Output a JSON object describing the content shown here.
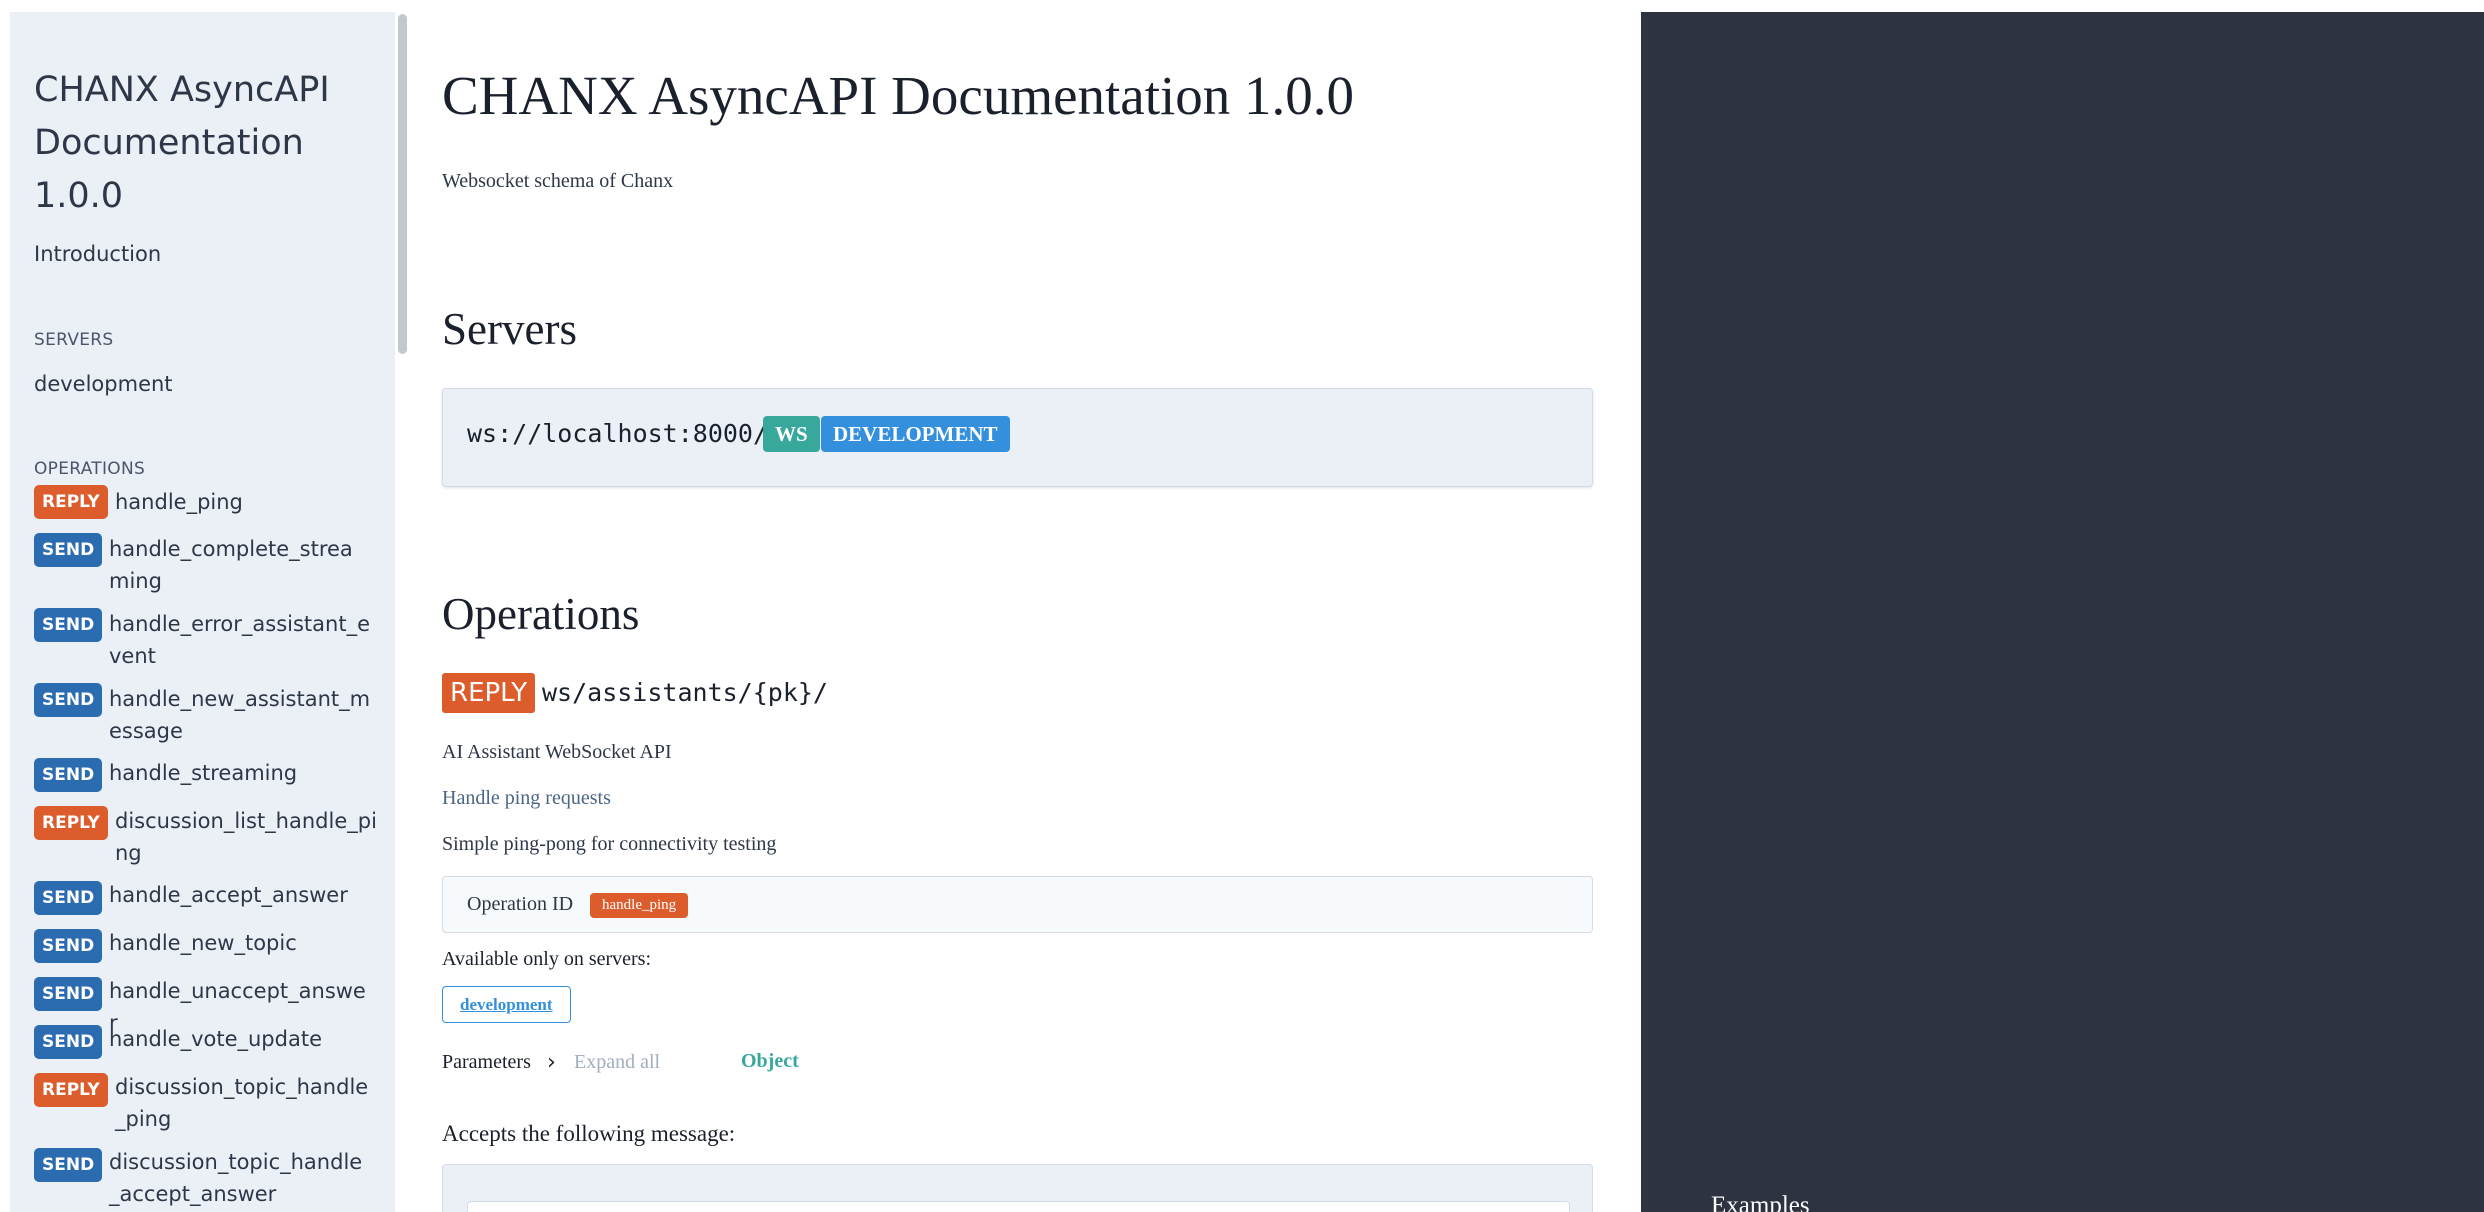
{
  "sidebar": {
    "title": "CHANX AsyncAPI Documentation 1.0.0",
    "introduction": "Introduction",
    "servers_heading": "SERVERS",
    "servers": [
      "development"
    ],
    "operations_heading": "OPERATIONS",
    "operations": [
      {
        "type": "REPLY",
        "name": "handle_ping"
      },
      {
        "type": "SEND",
        "name": "handle_complete_streaming"
      },
      {
        "type": "SEND",
        "name": "handle_error_assistant_event"
      },
      {
        "type": "SEND",
        "name": "handle_new_assistant_message"
      },
      {
        "type": "SEND",
        "name": "handle_streaming"
      },
      {
        "type": "REPLY",
        "name": "discussion_list_handle_ping"
      },
      {
        "type": "SEND",
        "name": "handle_accept_answer"
      },
      {
        "type": "SEND",
        "name": "handle_new_topic"
      },
      {
        "type": "SEND",
        "name": "handle_unaccept_answer"
      },
      {
        "type": "SEND",
        "name": "handle_vote_update"
      },
      {
        "type": "REPLY",
        "name": "discussion_topic_handle_ping"
      },
      {
        "type": "SEND",
        "name": "discussion_topic_handle_accept_answer"
      }
    ]
  },
  "main": {
    "title": "CHANX AsyncAPI Documentation 1.0.0",
    "description": "Websocket schema of Chanx",
    "servers_heading": "Servers",
    "server": {
      "url": "ws://localhost:8000/",
      "protocol": "WS",
      "environment": "DEVELOPMENT"
    },
    "operations_heading": "Operations",
    "operation": {
      "type": "REPLY",
      "channel": "ws/assistants/{pk}/",
      "channel_description": "AI Assistant WebSocket API",
      "summary": "Handle ping requests",
      "description": "Simple ping-pong for connectivity testing",
      "operation_id_label": "Operation ID",
      "operation_id": "handle_ping",
      "available_label": "Available only on servers:",
      "available_server": "development",
      "parameters_label": "Parameters",
      "expand_all": "Expand all",
      "parameters_type": "Object",
      "accepts_label": "Accepts the following message:"
    }
  },
  "right_panel": {
    "examples_label": "Examples"
  },
  "colors": {
    "reply": "#dd5c2c",
    "send": "#2b6cb0",
    "ws_tag": "#38a89d",
    "dev_tag": "#3490dc",
    "dark_panel": "#2d3340",
    "sidebar_bg": "#ebf0f7"
  }
}
